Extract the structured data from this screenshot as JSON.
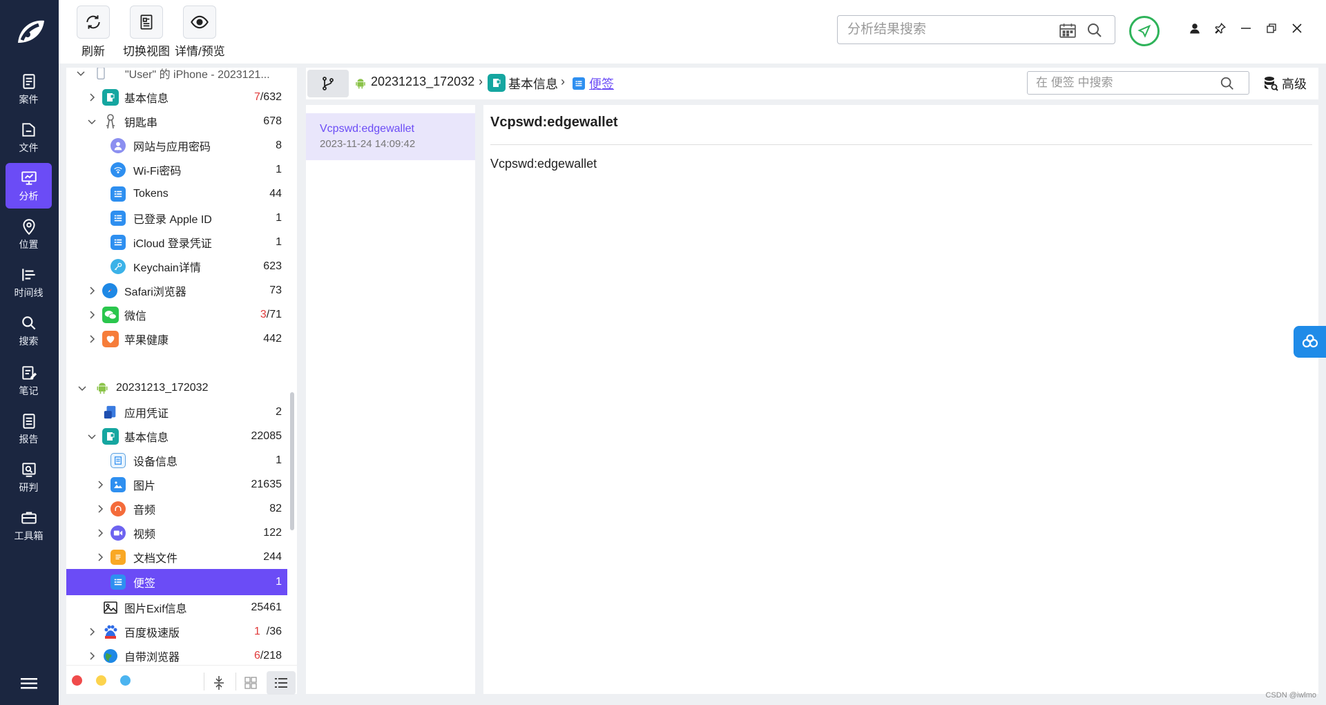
{
  "nav": {
    "items": [
      {
        "label": "案件",
        "icon": "clipboard-icon"
      },
      {
        "label": "文件",
        "icon": "folder-icon"
      },
      {
        "label": "分析",
        "icon": "analysis-monitor-icon",
        "active": true
      },
      {
        "label": "位置",
        "icon": "location-pin-icon"
      },
      {
        "label": "时间线",
        "icon": "timeline-icon"
      },
      {
        "label": "搜索",
        "icon": "search-icon"
      },
      {
        "label": "笔记",
        "icon": "note-icon"
      },
      {
        "label": "报告",
        "icon": "report-icon"
      },
      {
        "label": "研判",
        "icon": "judge-icon"
      },
      {
        "label": "工具箱",
        "icon": "toolbox-icon"
      }
    ]
  },
  "toolbar": {
    "refresh_label": "刷新",
    "switch_view_label": "切换视图",
    "detail_preview_label": "详情/预览",
    "search_placeholder": "分析结果搜索"
  },
  "tree": {
    "rows": [
      {
        "label": "\"User\" 的 iPhone - 2023121...",
        "count": ""
      },
      {
        "label": "基本信息",
        "count_red": "7",
        "count": "/632"
      },
      {
        "label": "钥匙串",
        "count": "678"
      },
      {
        "label": "网站与应用密码",
        "count": "8"
      },
      {
        "label": "Wi-Fi密码",
        "count": "1"
      },
      {
        "label": "Tokens",
        "count": "44"
      },
      {
        "label": "已登录 Apple ID",
        "count": "1"
      },
      {
        "label": "iCloud 登录凭证",
        "count": "1"
      },
      {
        "label": "Keychain详情",
        "count": "623"
      },
      {
        "label": "Safari浏览器",
        "count": "73"
      },
      {
        "label": "微信",
        "count_red": "3",
        "count": "/71"
      },
      {
        "label": "苹果健康",
        "count": "442"
      },
      {
        "label": "20231213_172032",
        "count": ""
      },
      {
        "label": "应用凭证",
        "count": "2"
      },
      {
        "label": "基本信息",
        "count": "22085"
      },
      {
        "label": "设备信息",
        "count": "1"
      },
      {
        "label": "图片",
        "count": "21635"
      },
      {
        "label": "音频",
        "count": "82"
      },
      {
        "label": "视频",
        "count": "122"
      },
      {
        "label": "文档文件",
        "count": "244"
      },
      {
        "label": "便签",
        "count": "1"
      },
      {
        "label": "图片Exif信息",
        "count": "25461"
      },
      {
        "label": "百度极速版",
        "count_red": "1",
        "count": "/36"
      },
      {
        "label": "自带浏览器",
        "count_red": "6",
        "count": "/218"
      }
    ]
  },
  "breadcrumb": {
    "items": [
      "20231213_172032",
      "基本信息",
      "便签"
    ],
    "search_placeholder": "在 便签 中搜索",
    "advanced_label": "高级"
  },
  "list": {
    "items": [
      {
        "title": "Vcpswd:edgewallet",
        "time": "2023-11-24 14:09:42"
      }
    ]
  },
  "detail": {
    "title": "Vcpswd:edgewallet",
    "body": "Vcpswd:edgewallet"
  },
  "watermark": "CSDN @iwlmo",
  "colors": {
    "accent": "#6b4cf6",
    "nav_bg": "#1b2640",
    "dot_red": "#f04b4b",
    "dot_yellow": "#fcd34d",
    "dot_blue": "#4cb4f0"
  }
}
